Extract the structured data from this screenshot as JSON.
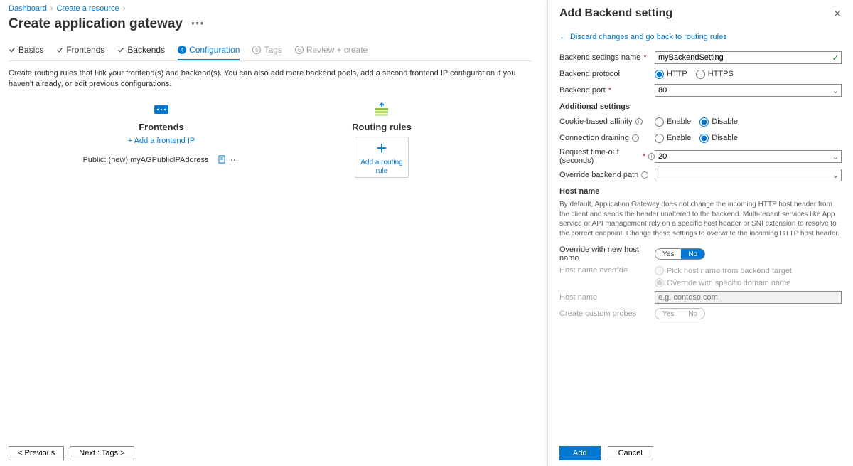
{
  "breadcrumb": {
    "item1": "Dashboard",
    "item2": "Create a resource"
  },
  "page_title": "Create application gateway",
  "tabs": {
    "basics": "Basics",
    "frontends": "Frontends",
    "backends": "Backends",
    "configuration": "Configuration",
    "tags_num": "5",
    "tags": "Tags",
    "review_num": "6",
    "review": "Review + create"
  },
  "description": "Create routing rules that link your frontend(s) and backend(s). You can also add more backend pools, add a second frontend IP configuration if you haven't already, or edit previous configurations.",
  "diagram": {
    "frontends": {
      "title": "Frontends",
      "add_link": "+ Add a frontend IP",
      "item": "Public: (new) myAGPublicIPAddress"
    },
    "rules": {
      "title": "Routing rules",
      "card_label": "Add a routing rule"
    }
  },
  "footer": {
    "prev": "< Previous",
    "next": "Next : Tags >"
  },
  "panel": {
    "title": "Add Backend setting",
    "discard": "Discard changes and go back to routing rules",
    "labels": {
      "name": "Backend settings name",
      "protocol": "Backend protocol",
      "port": "Backend port",
      "additional": "Additional settings",
      "affinity": "Cookie-based affinity",
      "drain": "Connection draining",
      "timeout": "Request time-out (seconds)",
      "override_path": "Override backend path",
      "hostname_hdr": "Host name",
      "hostname_desc": "By default, Application Gateway does not change the incoming HTTP host header from the client and sends the header unaltered to the backend. Multi-tenant services like App service or API management rely on a specific host header or SNI extension to resolve to the correct endpoint. Change these settings to overwrite the incoming HTTP host header.",
      "override_new": "Override with new host name",
      "hn_override": "Host name override",
      "hn_override_opt1": "Pick host name from backend target",
      "hn_override_opt2": "Override with specific domain name",
      "host_name": "Host name",
      "create_probes": "Create custom probes"
    },
    "values": {
      "name": "myBackendSetting",
      "port": "80",
      "timeout": "20",
      "hostname_ph": "e.g. contoso.com"
    },
    "radio": {
      "http": "HTTP",
      "https": "HTTPS",
      "enable": "Enable",
      "disable": "Disable",
      "yes": "Yes",
      "no": "No"
    },
    "footer": {
      "add": "Add",
      "cancel": "Cancel"
    }
  }
}
